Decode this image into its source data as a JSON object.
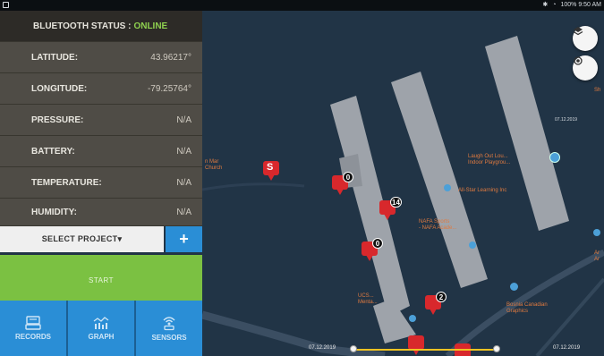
{
  "status_bar": {
    "right_text": "100% 9:50 AM"
  },
  "panel": {
    "bluetooth_label": "BLUETOOTH STATUS :",
    "bluetooth_status": "ONLINE",
    "rows": [
      {
        "label": "LATITUDE:",
        "value": "43.96217°"
      },
      {
        "label": "LONGITUDE:",
        "value": "-79.25764°"
      },
      {
        "label": "PRESSURE:",
        "value": "N/A"
      },
      {
        "label": "BATTERY:",
        "value": "N/A"
      },
      {
        "label": "TEMPERATURE:",
        "value": "N/A"
      },
      {
        "label": "HUMIDITY:",
        "value": "N/A"
      }
    ],
    "select_project": "SELECT PROJECT▾",
    "add_label": "+",
    "start_label": "START",
    "nav": [
      {
        "label": "RECORDS",
        "icon": "records-icon"
      },
      {
        "label": "GRAPH",
        "icon": "graph-icon"
      },
      {
        "label": "SENSORS",
        "icon": "sensors-icon"
      }
    ]
  },
  "map": {
    "labels": {
      "church": "n Mar\nChurch",
      "laugh_out": "Laugh Out Lou...\nIndoor Playgrou...",
      "all_star": "All-Star Learning Inc",
      "nafa": "NAFA Sports\n- NAFA Acade...",
      "ucs": "UCS...\nMenta...",
      "bosnia": "Bosnia Canadian\nGraphics",
      "right_edge_1": "Sh",
      "right_edge_2": "Ar\nAr",
      "date_tag": "07.12.2019"
    },
    "markers": [
      {
        "type": "s",
        "letter": "S"
      },
      {
        "type": "count",
        "count": "0"
      },
      {
        "type": "count",
        "count": "14"
      },
      {
        "type": "count",
        "count": "0"
      },
      {
        "type": "count",
        "count": "2"
      }
    ],
    "timeline": {
      "start": "07.12.2019",
      "end": "07.12.2019"
    }
  },
  "colors": {
    "accent_blue": "#2a8ed6",
    "start_green": "#7bc142",
    "marker_red": "#d8282c",
    "online_green": "#8fd14f"
  }
}
